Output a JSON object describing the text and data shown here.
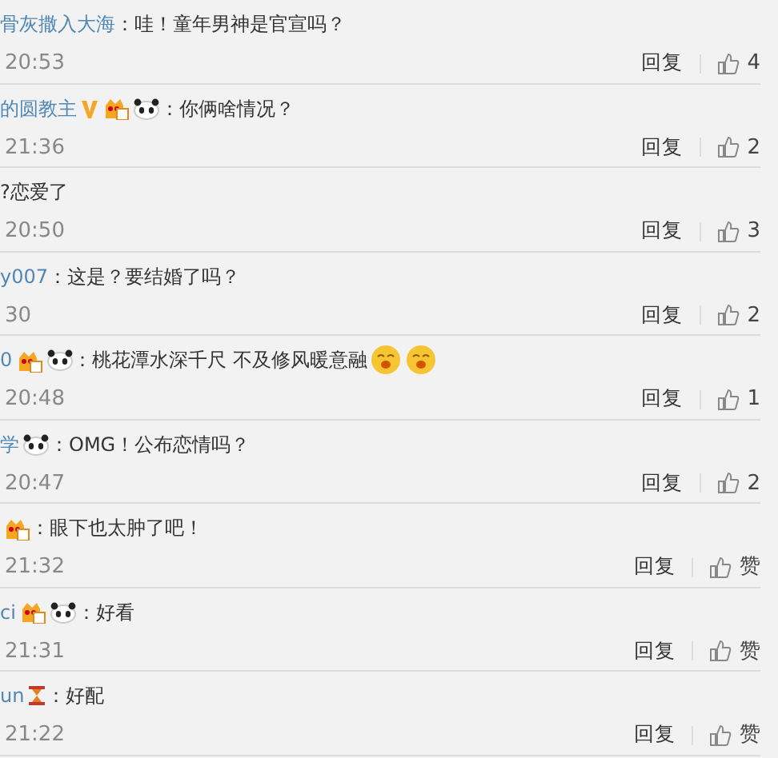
{
  "comments": [
    {
      "name": "骨灰撒入大海",
      "text": "：哇！童年男神是官宣吗？",
      "time": "20:53",
      "reply": "回复",
      "likes": "4"
    },
    {
      "name": "的圆教主",
      "badges": [
        {
          "kind": "vip"
        },
        {
          "kind": "level"
        },
        {
          "kind": "panda"
        }
      ],
      "text": "：你俩啥情况？",
      "time": "21:36",
      "reply": "回复",
      "likes": "2"
    },
    {
      "text": "?恋爱了",
      "time": "20:50",
      "reply": "回复",
      "likes": "3"
    },
    {
      "name": "y007",
      "text": "：这是？要结婚了吗？",
      "time": "30",
      "reply": "回复",
      "likes": "2"
    },
    {
      "name": "0",
      "badges": [
        {
          "kind": "level"
        },
        {
          "kind": "panda"
        }
      ],
      "text": "：桃花潭水深千尺 不及修风暖意融",
      "emojis": [
        {
          "kind": "face"
        },
        {
          "kind": "face"
        }
      ],
      "time": "20:48",
      "reply": "回复",
      "likes": "1"
    },
    {
      "name": "学",
      "badges": [
        {
          "kind": "panda"
        }
      ],
      "text": "：OMG！公布恋情吗？",
      "time": "20:47",
      "reply": "回复",
      "likes": "2"
    },
    {
      "badges": [
        {
          "kind": "level"
        }
      ],
      "text": "：眼下也太肿了吧！",
      "time": "21:32",
      "reply": "回复",
      "likes": "赞"
    },
    {
      "name": "ci",
      "badges": [
        {
          "kind": "level"
        },
        {
          "kind": "panda"
        }
      ],
      "text": "：好看",
      "time": "21:31",
      "reply": "回复",
      "likes": "赞"
    },
    {
      "name": "un",
      "badges": [
        {
          "kind": "hourglass"
        }
      ],
      "text": "：好配",
      "time": "21:22",
      "reply": "回复",
      "likes": "赞"
    }
  ]
}
